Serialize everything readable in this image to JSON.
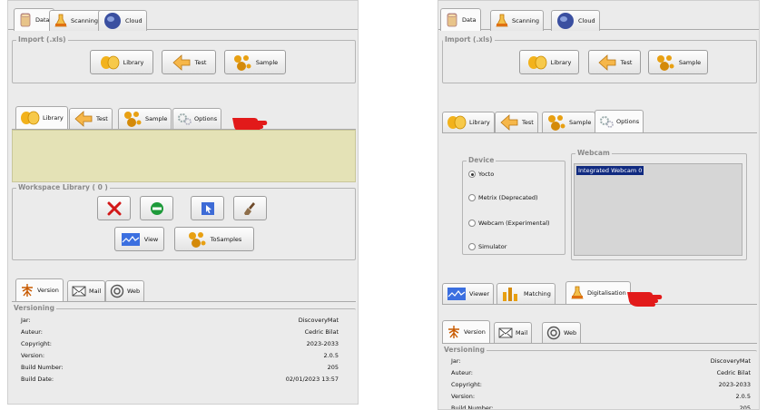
{
  "top_tabs": [
    "Data",
    "Scanning",
    "Cloud"
  ],
  "import": {
    "legend": "Import (.xls)",
    "buttons": [
      "Library",
      "Test",
      "Sample"
    ]
  },
  "left": {
    "mid_tabs": [
      "Library",
      "Test",
      "Sample",
      "Options"
    ],
    "workspace": {
      "legend": "Workspace Library ( 0 )",
      "view_label": "View",
      "tosamples_label": "ToSamples"
    }
  },
  "right": {
    "options_tabs": [
      "Library",
      "Test",
      "Sample",
      "Options"
    ],
    "device": {
      "legend": "Device",
      "options": [
        "Yocto",
        "Metrix (Deprecated)",
        "Webcam (Experimental)",
        "Simulator"
      ],
      "selected": "Yocto"
    },
    "webcam": {
      "legend": "Webcam",
      "items": [
        "Integrated Webcam 0"
      ]
    },
    "bottom_tabs": [
      "Viewer",
      "Matching",
      "Digitalisation"
    ]
  },
  "about_tabs": [
    "Version",
    "Mail",
    "Web"
  ],
  "versioning": {
    "legend": "Versioning",
    "rows": [
      {
        "label": "Jar:",
        "value": "DiscoveryMat"
      },
      {
        "label": "Auteur:",
        "value": "Cedric Bilat"
      },
      {
        "label": "Copyright:",
        "value": "2023-2033"
      },
      {
        "label": "Version:",
        "value": "2.0.5"
      },
      {
        "label": "Build Number:",
        "value": "205"
      },
      {
        "label": "Build Date:",
        "value": "02/01/2023 13:57"
      }
    ]
  },
  "colors": {
    "panel": "#ebebeb",
    "yellow_area": "#e4e2b6",
    "selection": "#102a80",
    "pointer": "#e21a1a"
  }
}
